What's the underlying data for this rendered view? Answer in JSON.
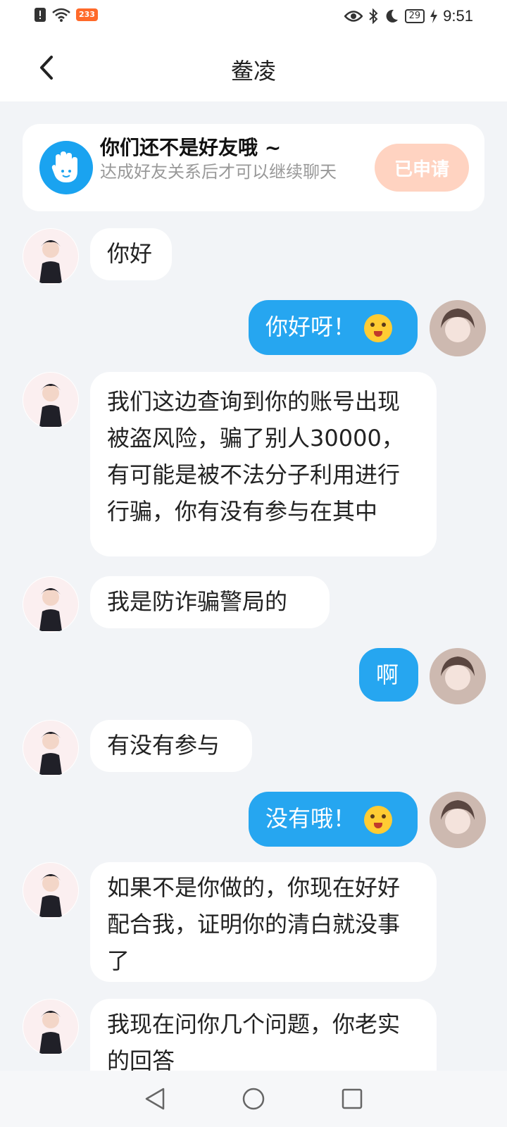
{
  "status_bar": {
    "time": "9:51",
    "battery": "29",
    "badge": "233",
    "icons": [
      "alert-icon",
      "wifi-icon",
      "eye-icon",
      "bluetooth-icon",
      "moon-icon",
      "battery-icon",
      "charging-icon"
    ]
  },
  "header": {
    "title": "鲞凌"
  },
  "banner": {
    "title": "你们还不是好友哦 ~",
    "subtitle": "达成好友关系后才可以继续聊天",
    "button": "已申请",
    "icon": "hand-wave-icon"
  },
  "messages": [
    {
      "side": "left",
      "text": "你好"
    },
    {
      "side": "right",
      "text": "你好呀！",
      "emoji": "kiss-emoji"
    },
    {
      "side": "left",
      "text": "我们这边查询到你的账号出现被盗风险，骗了别人30000，有可能是被不法分子利用进行行骗，你有没有参与在其中"
    },
    {
      "side": "left",
      "text": "我是防诈骗警局的"
    },
    {
      "side": "right",
      "text": "啊"
    },
    {
      "side": "left",
      "text": "有没有参与"
    },
    {
      "side": "right",
      "text": "没有哦！",
      "emoji": "tongue-emoji"
    },
    {
      "side": "left",
      "text": "如果不是你做的，你现在好好配合我，证明你的清白就没事了"
    },
    {
      "side": "left",
      "text": "我现在问你几个问题，你老实的回答"
    }
  ],
  "colors": {
    "sent_bubble": "#26a6f0",
    "received_bubble": "#ffffff",
    "banner_button": "#ffd3c1",
    "background": "#f2f4f7"
  },
  "nav": [
    "back-triangle-icon",
    "home-circle-icon",
    "recents-square-icon"
  ]
}
